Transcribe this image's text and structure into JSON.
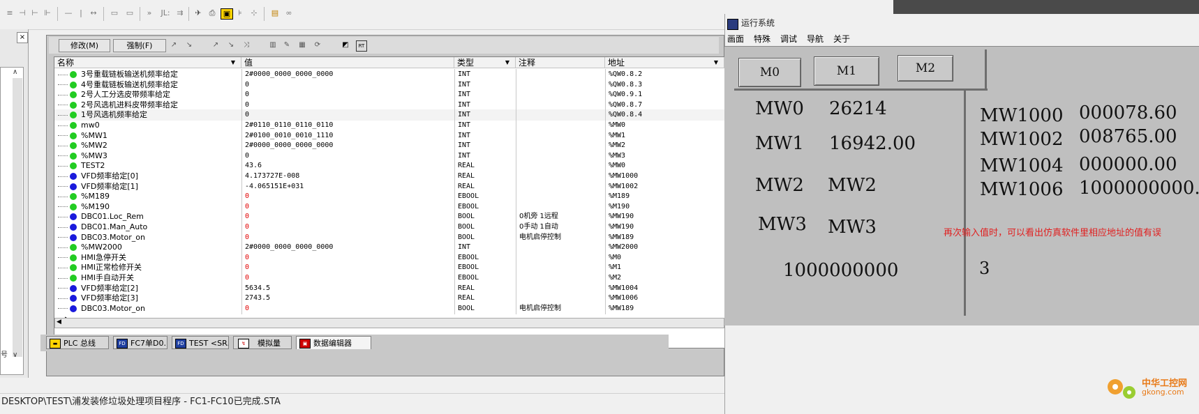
{
  "toolbar": {
    "icons": [
      "align-left-icon",
      "align-right-icon",
      "align-center-icon",
      "align-justify-icon",
      "dash-icon",
      "pipe-icon",
      "arrows-icon",
      "compile-icon",
      "compile-all-icon",
      "jump-icon",
      "jl-icon",
      "step-icon",
      "tools-icon",
      "print-icon",
      "monitor-icon",
      "pin-icon",
      "stop-icon",
      "folder-icon",
      "glasses-icon"
    ],
    "jl_label": "JL:"
  },
  "left_panel": {
    "close_label": "×",
    "scroll_up": "∧",
    "scroll_down": "∨",
    "side_char": "号"
  },
  "inner_toolbar": {
    "modify_label": "修改(M)",
    "force_label": "强制(F)",
    "rt_label": "RT"
  },
  "table": {
    "headers": {
      "name": "名称",
      "value": "值",
      "type": "类型",
      "note": "注释",
      "address": "地址"
    },
    "rows": [
      {
        "dot": "green",
        "name": "3号重载链板输送机频率给定",
        "value": "2#0000_0000_0000_0000",
        "red": false,
        "type": "INT",
        "note": "",
        "address": "%QW0.8.2"
      },
      {
        "dot": "green",
        "name": "4号重载链板输送机频率给定",
        "value": "0",
        "red": false,
        "type": "INT",
        "note": "",
        "address": "%QW0.8.3"
      },
      {
        "dot": "green",
        "name": "2号人工分选皮带频率给定",
        "value": "0",
        "red": false,
        "type": "INT",
        "note": "",
        "address": "%QW0.9.1"
      },
      {
        "dot": "green",
        "name": "2号风选机进料皮带频率给定",
        "value": "0",
        "red": false,
        "type": "INT",
        "note": "",
        "address": "%QW0.8.7"
      },
      {
        "dot": "green",
        "name": "1号风选机频率给定",
        "value": "0",
        "red": false,
        "type": "INT",
        "note": "",
        "address": "%QW0.8.4"
      },
      {
        "dot": "green",
        "name": "mw0",
        "value": "2#0110_0110_0110_0110",
        "red": false,
        "type": "INT",
        "note": "",
        "address": "%MW0"
      },
      {
        "dot": "green",
        "name": "%MW1",
        "value": "2#0100_0010_0010_1110",
        "red": false,
        "type": "INT",
        "note": "",
        "address": "%MW1"
      },
      {
        "dot": "green",
        "name": "%MW2",
        "value": "2#0000_0000_0000_0000",
        "red": false,
        "type": "INT",
        "note": "",
        "address": "%MW2"
      },
      {
        "dot": "green",
        "name": "%MW3",
        "value": "0",
        "red": false,
        "type": "INT",
        "note": "",
        "address": "%MW3"
      },
      {
        "dot": "green",
        "name": "TEST2",
        "value": "43.6",
        "red": false,
        "type": "REAL",
        "note": "",
        "address": "%MW0"
      },
      {
        "dot": "blue",
        "name": "VFD频率给定[0]",
        "value": "4.173727E-008",
        "red": false,
        "type": "REAL",
        "note": "",
        "address": "%MW1000"
      },
      {
        "dot": "blue",
        "name": "VFD频率给定[1]",
        "value": "-4.065151E+031",
        "red": false,
        "type": "REAL",
        "note": "",
        "address": "%MW1002"
      },
      {
        "dot": "green",
        "name": "%M189",
        "value": "0",
        "red": true,
        "type": "EBOOL",
        "note": "",
        "address": "%M189"
      },
      {
        "dot": "green",
        "name": "%M190",
        "value": "0",
        "red": true,
        "type": "EBOOL",
        "note": "",
        "address": "%M190"
      },
      {
        "dot": "blue",
        "name": "DBC01.Loc_Rem",
        "value": "0",
        "red": true,
        "type": "BOOL",
        "note": "0机旁 1远程",
        "address": "%MW190"
      },
      {
        "dot": "blue",
        "name": "DBC01.Man_Auto",
        "value": "0",
        "red": true,
        "type": "BOOL",
        "note": "0手动 1自动",
        "address": "%MW190"
      },
      {
        "dot": "blue",
        "name": "DBC03.Motor_on",
        "value": "0",
        "red": true,
        "type": "BOOL",
        "note": "电机启停控制",
        "address": "%MW189"
      },
      {
        "dot": "green",
        "name": "%MW2000",
        "value": "2#0000_0000_0000_0000",
        "red": false,
        "type": "INT",
        "note": "",
        "address": "%MW2000"
      },
      {
        "dot": "green",
        "name": "HMI急停开关",
        "value": "0",
        "red": true,
        "type": "EBOOL",
        "note": "",
        "address": "%M0"
      },
      {
        "dot": "green",
        "name": "HMI正常检修开关",
        "value": "0",
        "red": true,
        "type": "EBOOL",
        "note": "",
        "address": "%M1"
      },
      {
        "dot": "green",
        "name": "HMI手自动开关",
        "value": "0",
        "red": true,
        "type": "EBOOL",
        "note": "",
        "address": "%M2"
      },
      {
        "dot": "blue",
        "name": "VFD频率给定[2]",
        "value": "5634.5",
        "red": false,
        "type": "REAL",
        "note": "",
        "address": "%MW1004"
      },
      {
        "dot": "blue",
        "name": "VFD频率给定[3]",
        "value": "2743.5",
        "red": false,
        "type": "REAL",
        "note": "",
        "address": "%MW1006"
      },
      {
        "dot": "blue",
        "name": "DBC03.Motor_on",
        "value": "0",
        "red": true,
        "type": "BOOL",
        "note": "电机启停控制",
        "address": "%MW189"
      }
    ],
    "more_marker": "▸"
  },
  "bottom_tabs": [
    {
      "label": "PLC 总线",
      "icon": "bus-icon"
    },
    {
      "label": "FC7单D0...",
      "icon": "fd-icon"
    },
    {
      "label": "TEST <SR...",
      "icon": "fd-icon"
    },
    {
      "label": "模拟量",
      "icon": "analog-icon"
    },
    {
      "label": "数据编辑器",
      "icon": "data-editor-icon"
    }
  ],
  "status_bar": {
    "path": "DESKTOP\\TEST\\浦发装修垃圾处理项目程序 - FC1-FC10已完成.STA"
  },
  "runtime": {
    "title": "运行系统",
    "menu": [
      "画面",
      "特殊",
      "调试",
      "导航",
      "关于"
    ],
    "buttons": [
      "M0",
      "M1",
      "M2"
    ],
    "left": [
      {
        "label": "MW0",
        "value": "26214"
      },
      {
        "label": "MW1",
        "value": "16942.00"
      },
      {
        "label": "MW2",
        "value": "MW2"
      },
      {
        "label": "MW3",
        "value": "MW3"
      }
    ],
    "big_value": "1000000000",
    "small_value": "3",
    "right": [
      {
        "label": "MW1000",
        "value": "000078.60"
      },
      {
        "label": "MW1002",
        "value": "008765.00"
      },
      {
        "label": "MW1004",
        "value": "000000.00"
      },
      {
        "label": "MW1006",
        "value": "1000000000."
      }
    ],
    "note": "再次输入值时，可以看出仿真软件里相应地址的值有误"
  },
  "watermark": {
    "line1": "中华工控网",
    "line2": "gkong.com"
  },
  "colors": {
    "green_dot": "#22cc22",
    "blue_dot": "#1a1adc",
    "red_value": "#e00000",
    "runtime_bg": "#bfbfbf",
    "note_red": "#e02020"
  }
}
